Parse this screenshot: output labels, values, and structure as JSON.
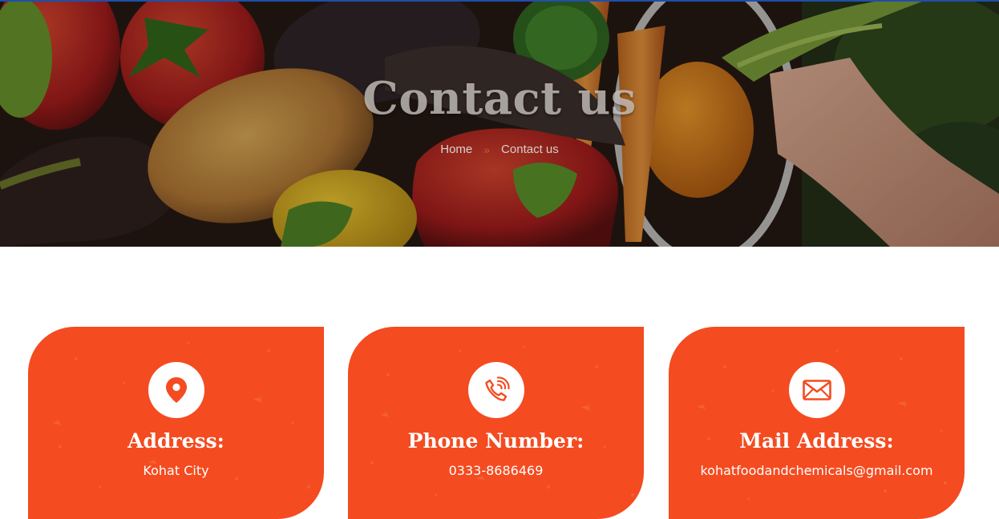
{
  "hero": {
    "title": "Contact us",
    "breadcrumb": {
      "home": "Home",
      "separator": "»",
      "current": "Contact us"
    }
  },
  "cards": [
    {
      "icon": "map-pin-icon",
      "title": "Address:",
      "value": "Kohat City"
    },
    {
      "icon": "phone-call-icon",
      "title": "Phone Number:",
      "value": "0333-8686469"
    },
    {
      "icon": "mail-icon",
      "title": "Mail Address:",
      "value": "kohatfoodandchemicals@gmail.com"
    }
  ],
  "colors": {
    "accent": "#f44b20",
    "header_accent": "#1f4fa8",
    "breadcrumb_separator": "#d4512a"
  }
}
